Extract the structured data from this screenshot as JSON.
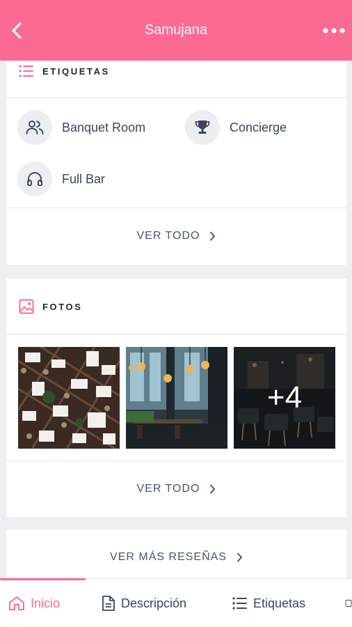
{
  "header": {
    "title": "Samujana",
    "back_icon": "chevron-left-icon",
    "more_icon": "more-horizontal-icon",
    "background": "#fb6a90"
  },
  "etiquetas": {
    "title": "ETIQUETAS",
    "icon": "list-icon",
    "items": [
      {
        "label": "Banquet Room",
        "icon": "users-icon"
      },
      {
        "label": "Concierge",
        "icon": "trophy-icon"
      },
      {
        "label": "Full Bar",
        "icon": "headphones-icon"
      }
    ],
    "see_all": "VER TODO"
  },
  "fotos": {
    "title": "FOTOS",
    "icon": "image-icon",
    "more_count": "+4",
    "see_all": "VER TODO"
  },
  "reviews": {
    "see_more": "VER MÁS RESEÑAS"
  },
  "tabbar": {
    "accent": "#fb6a90",
    "tabs": [
      {
        "label": "Inicio",
        "icon": "home-icon",
        "active": true
      },
      {
        "label": "Descripción",
        "icon": "document-icon",
        "active": false
      },
      {
        "label": "Etiquetas",
        "icon": "list-icon",
        "active": false
      }
    ]
  }
}
